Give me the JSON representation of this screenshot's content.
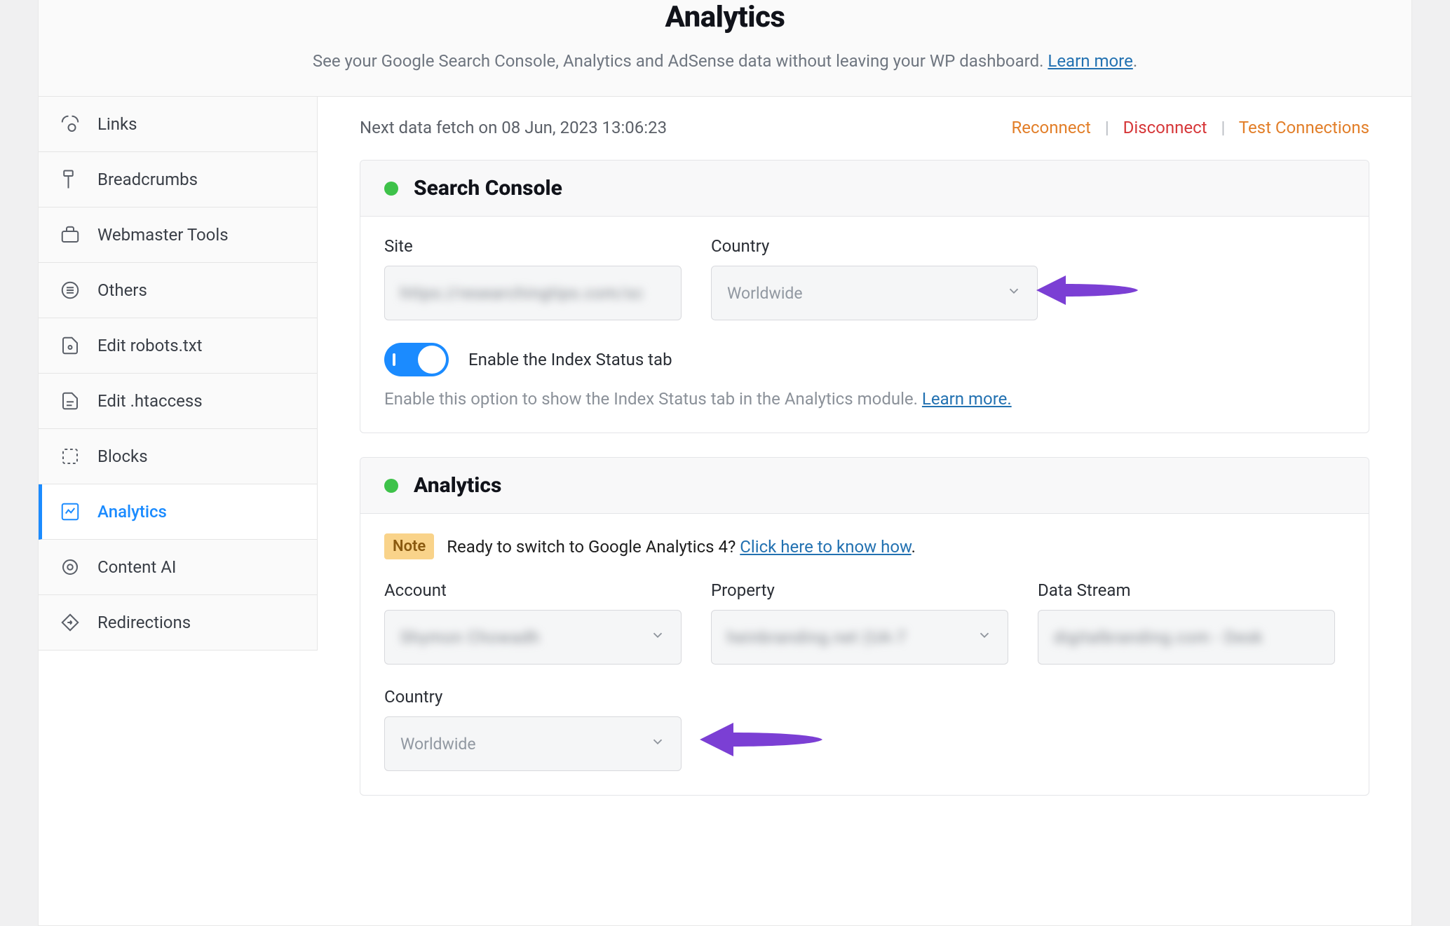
{
  "header": {
    "title": "Analytics",
    "subtitle_prefix": "See your Google Search Console, Analytics and AdSense data without leaving your WP dashboard. ",
    "learn_more": "Learn more",
    "subtitle_suffix": "."
  },
  "sidebar": [
    {
      "label": "Links"
    },
    {
      "label": "Breadcrumbs"
    },
    {
      "label": "Webmaster Tools"
    },
    {
      "label": "Others"
    },
    {
      "label": "Edit robots.txt"
    },
    {
      "label": "Edit .htaccess"
    },
    {
      "label": "Blocks"
    },
    {
      "label": "Analytics"
    },
    {
      "label": "Content AI"
    },
    {
      "label": "Redirections"
    }
  ],
  "top": {
    "fetch_text": "Next data fetch on 08 Jun, 2023 13:06:23",
    "reconnect": "Reconnect",
    "disconnect": "Disconnect",
    "test": "Test Connections"
  },
  "search_console": {
    "title": "Search Console",
    "site_label": "Site",
    "site_value": "https://researchingtips.com/sc",
    "country_label": "Country",
    "country_value": "Worldwide",
    "toggle_label": "Enable the Index Status tab",
    "help_prefix": "Enable this option to show the Index Status tab in the Analytics module. ",
    "learn_more": "Learn more."
  },
  "analytics_card": {
    "title": "Analytics",
    "note_badge": "Note",
    "note_text": "Ready to switch to Google Analytics 4? ",
    "note_link": "Click here to know how",
    "note_suffix": ".",
    "account_label": "Account",
    "account_value": "Shymon Chowadh",
    "property_label": "Property",
    "property_value": "heinbranding.net  (UA-7",
    "data_stream_label": "Data Stream",
    "data_stream_value": "digitalbranding.com - Desk",
    "country_label": "Country",
    "country_value": "Worldwide"
  }
}
